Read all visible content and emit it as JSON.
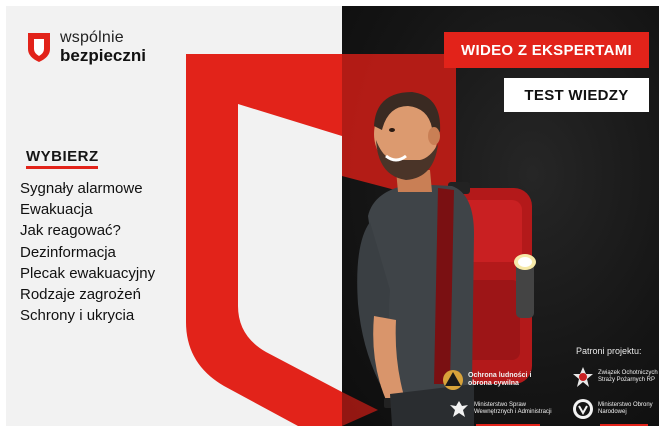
{
  "brand": {
    "line1": "wspólnie",
    "line2": "bezpieczni"
  },
  "buttons": {
    "video": "WIDEO Z EKSPERTAMI",
    "test": "TEST WIEDZY"
  },
  "menu": {
    "heading": "WYBIERZ",
    "items": [
      "Sygnały alarmowe",
      "Ewakuacja",
      "Jak reagować?",
      "Dezinformacja",
      "Plecak ewakuacyjny",
      "Rodzaje zagrożeń",
      "Schrony i ukrycia"
    ]
  },
  "patrons": {
    "title": "Patroni projektu:",
    "items": [
      {
        "label": "Ochrona ludności i obrona cywilna",
        "icon": "civil-defense-emblem-icon"
      },
      {
        "label": "Związek Ochotniczych Straży Pożarnych RP",
        "icon": "fire-brigade-emblem-icon"
      },
      {
        "label": "Ministerstwo Spraw Wewnętrznych i Administracji",
        "icon": "eagle-emblem-icon"
      },
      {
        "label": "Ministerstwo Obrony Narodowej",
        "icon": "defense-ministry-emblem-icon"
      }
    ]
  },
  "colors": {
    "accent": "#e2231a",
    "dark": "#151515",
    "light": "#f2f2f2"
  }
}
